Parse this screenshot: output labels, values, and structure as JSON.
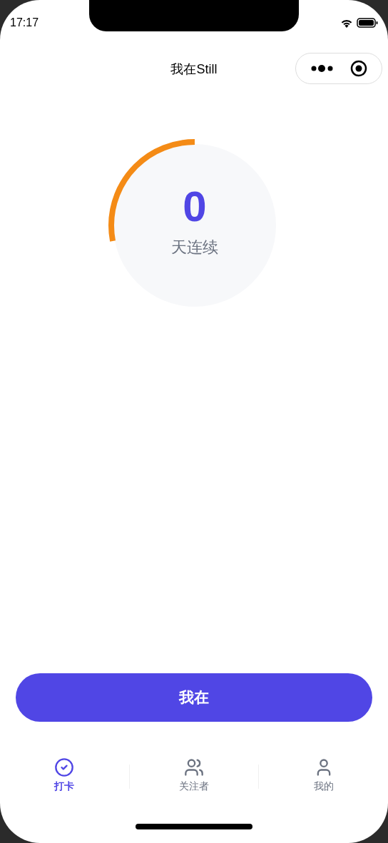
{
  "status_bar": {
    "time": "17:17"
  },
  "nav_bar": {
    "title": "我在Still"
  },
  "streak": {
    "count": "0",
    "label": "天连续",
    "level": 0.28
  },
  "primary_button": {
    "label": "我在"
  },
  "tabs": [
    {
      "label": "打卡",
      "kind": "checkin",
      "selected": true
    },
    {
      "label": "关注者",
      "kind": "followers",
      "selected": false
    },
    {
      "label": "我的",
      "kind": "profile",
      "selected": false
    }
  ]
}
